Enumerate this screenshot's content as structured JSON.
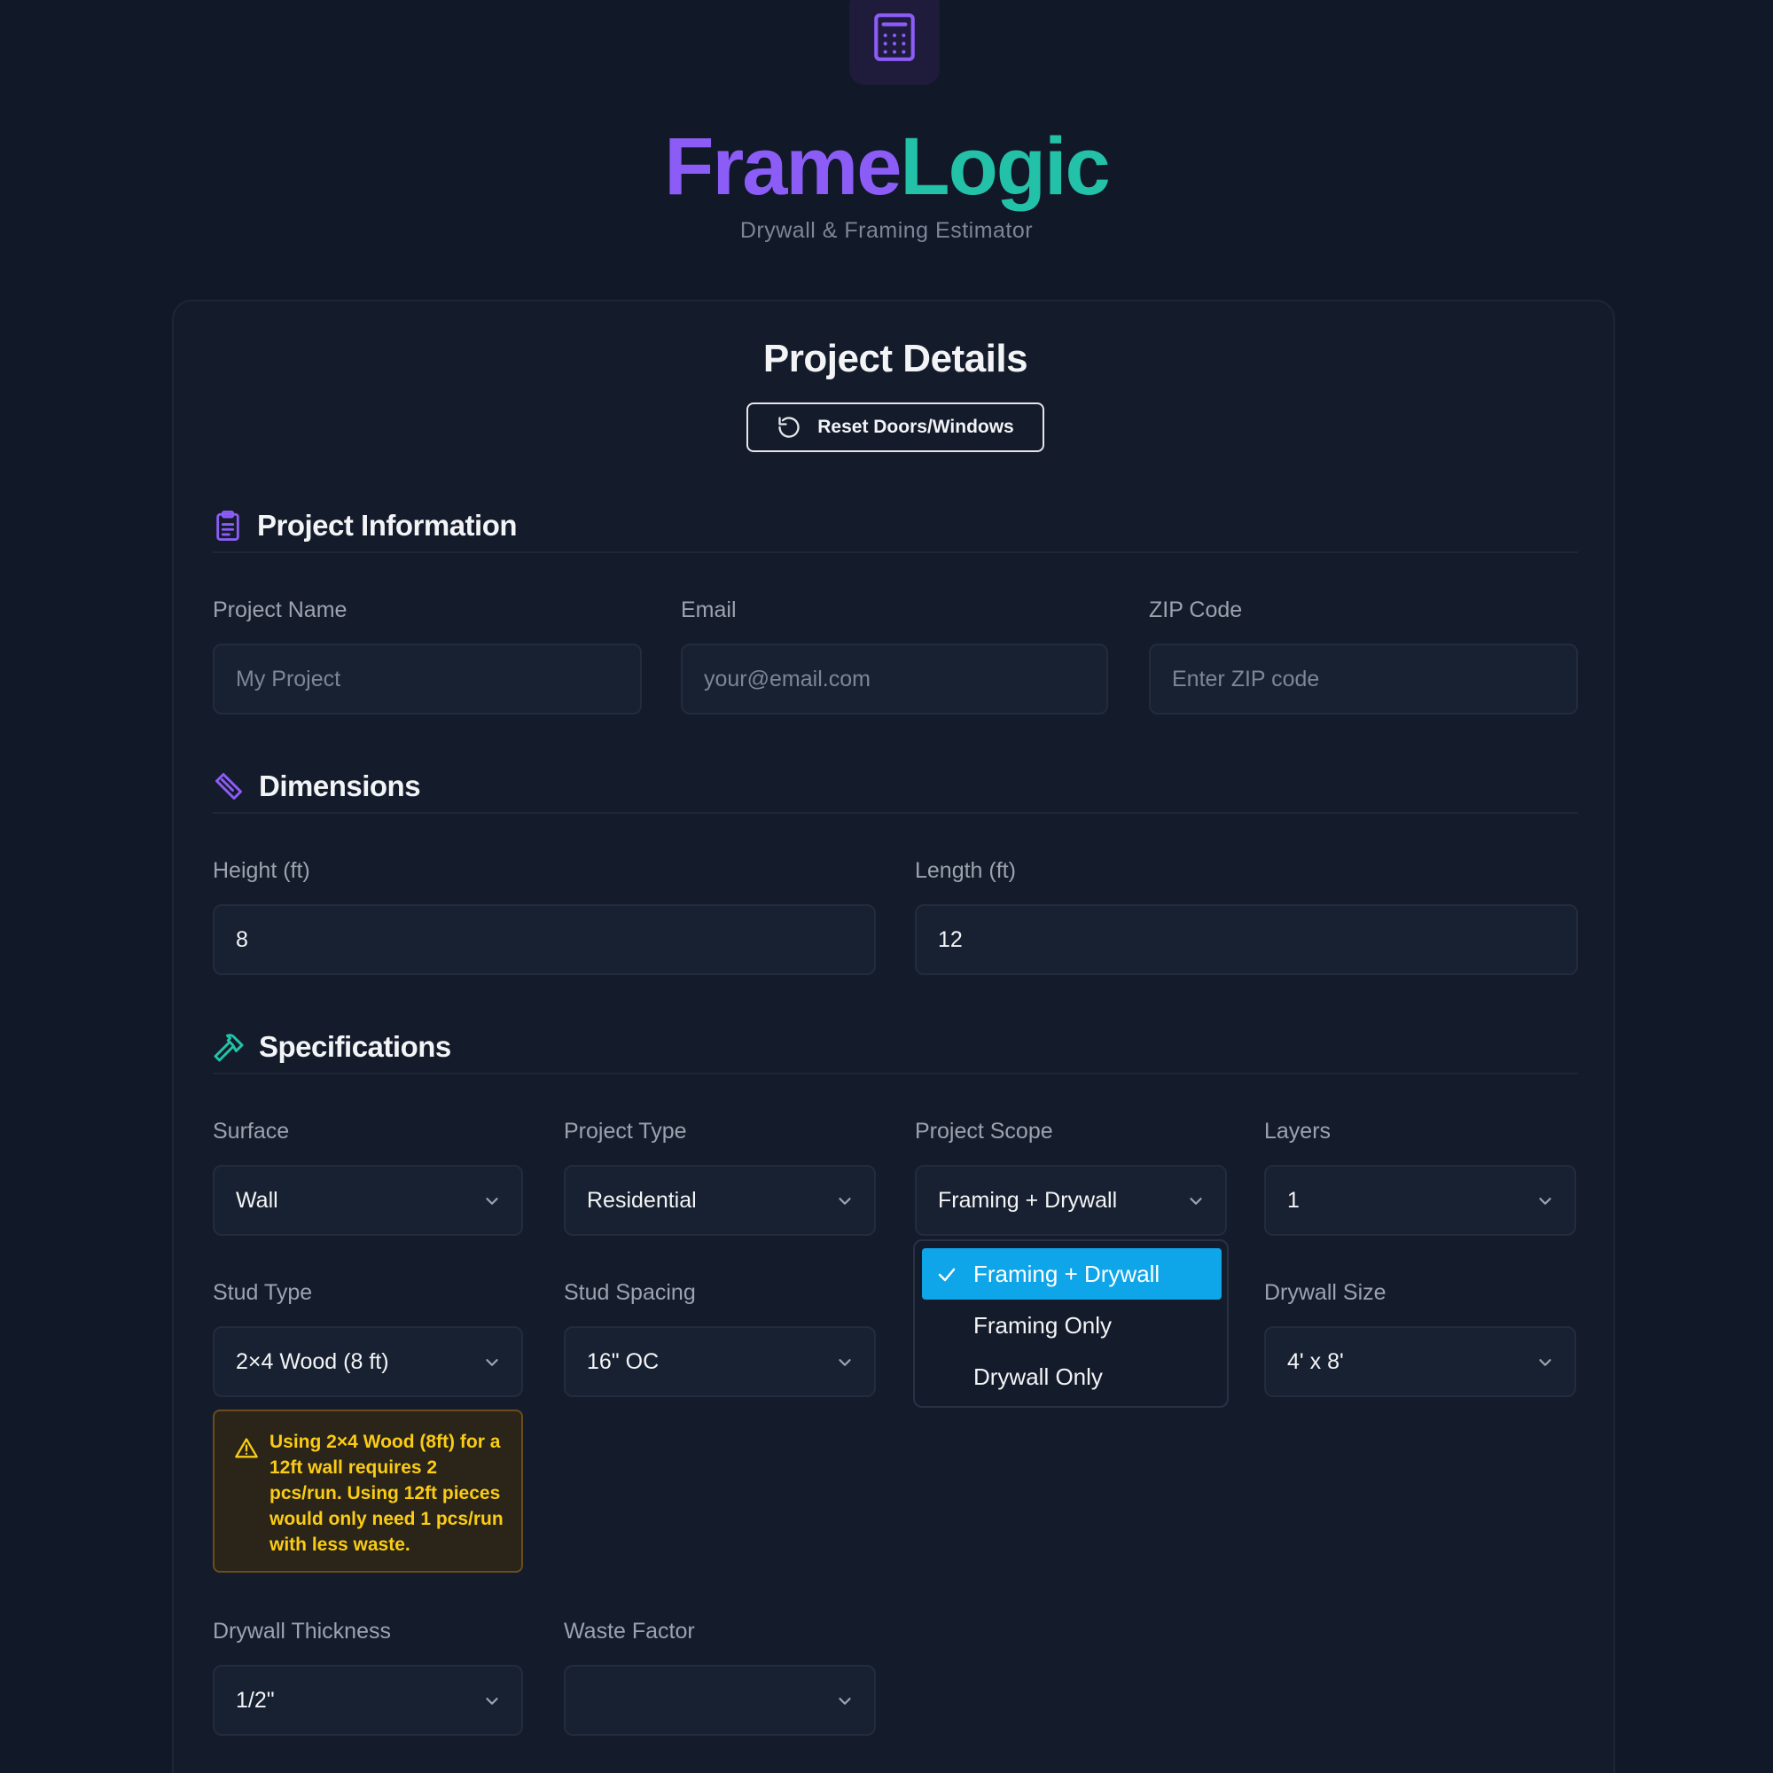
{
  "app": {
    "brand_part1": "Frame",
    "brand_part2": "Logic",
    "tagline": "Drywall & Framing Estimator"
  },
  "card": {
    "title": "Project Details",
    "reset_label": "Reset Doors/Windows"
  },
  "sections": {
    "project_info": "Project Information",
    "dimensions": "Dimensions",
    "specifications": "Specifications"
  },
  "project_info": {
    "name_label": "Project Name",
    "name_placeholder": "My Project",
    "email_label": "Email",
    "email_placeholder": "your@email.com",
    "zip_label": "ZIP Code",
    "zip_placeholder": "Enter ZIP code"
  },
  "dimensions": {
    "height_label": "Height (ft)",
    "height_value": "8",
    "length_label": "Length (ft)",
    "length_value": "12"
  },
  "specs": {
    "surface_label": "Surface",
    "surface_value": "Wall",
    "project_type_label": "Project Type",
    "project_type_value": "Residential",
    "scope_label": "Project Scope",
    "scope_value": "Framing + Drywall",
    "layers_label": "Layers",
    "layers_value": "1",
    "stud_type_label": "Stud Type",
    "stud_type_value": "2×4 Wood (8 ft)",
    "stud_spacing_label": "Stud Spacing",
    "stud_spacing_value": "16\" OC",
    "drywall_size_label": "Drywall Size",
    "drywall_size_value": "4' x 8'",
    "thickness_label": "Drywall Thickness",
    "thickness_value": "1/2\"",
    "waste_label": "Waste Factor",
    "waste_value": ""
  },
  "scope_options": [
    "Framing + Drywall",
    "Framing Only",
    "Drywall Only"
  ],
  "warning": {
    "text": "Using 2×4 Wood (8ft) for a 12ft wall requires 2 pcs/run. Using 12ft pieces would only need 1 pcs/run with less waste."
  },
  "colors": {
    "background": "#111827",
    "card": "#141b2b",
    "brand_purple": "#8b5cf6",
    "brand_teal": "#22c1a8",
    "selected_option": "#0ea5e9",
    "warning_text": "#facc15",
    "hammer_icon": "#22c1a8"
  },
  "icons": {
    "logo": "calculator-icon",
    "reset": "rotate-ccw-icon",
    "project_info": "clipboard-icon",
    "dimensions": "ruler-icon",
    "specifications": "hammer-icon",
    "select": "chevron-down-icon",
    "selected": "check-icon",
    "warning": "warning-triangle-icon"
  }
}
